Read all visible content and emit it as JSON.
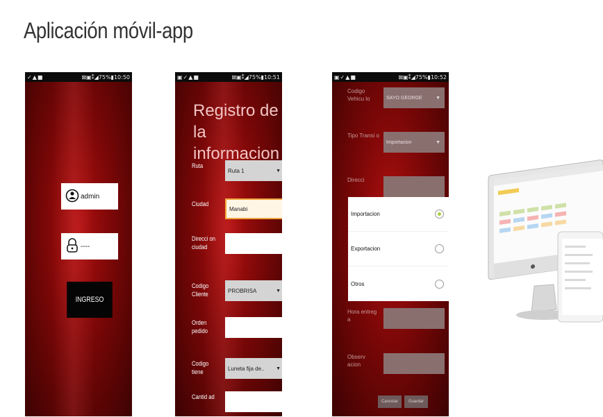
{
  "slide": {
    "title": "Aplicación móvil-app"
  },
  "status_bars": {
    "login": {
      "left": "✓▲■",
      "right": "⊠▣⁑◢75%▮10:50"
    },
    "form": {
      "left": "▣✓▲■",
      "right": "⊠▣⁑◢75%▮10:51"
    },
    "dialog": {
      "left": "▣✓▲■",
      "right": "⊠▣⁑◢75%▮10:52"
    }
  },
  "login": {
    "username": "admin",
    "password": "----",
    "submit_label": "INGRESO",
    "user_icon": "user-icon",
    "lock_icon": "lock-icon"
  },
  "form": {
    "title": "Registro de la informacion",
    "fields": [
      {
        "label": "Ruta",
        "value": "Ruta 1",
        "type": "select"
      },
      {
        "label": "Ciudad",
        "value": "Manabi",
        "type": "input-focused"
      },
      {
        "label": "Direcci on ciudad",
        "value": "",
        "type": "input"
      },
      {
        "label": "Codigo Cliente",
        "value": "PROBRISA",
        "type": "select"
      },
      {
        "label": "Orden pedido",
        "value": "",
        "type": "input"
      },
      {
        "label": "Codigo tiene",
        "value": "Luneta fija de..",
        "type": "select"
      },
      {
        "label": "Cantid ad",
        "value": "",
        "type": "input"
      }
    ]
  },
  "dialog_screen": {
    "background_fields": [
      {
        "label": "Codigo Vehicu lo",
        "value": "SAYO GEORGE",
        "type": "select"
      },
      {
        "label": "Tipo Transi o",
        "value": "Importacion",
        "type": "select"
      },
      {
        "label": "Direcci",
        "value": "",
        "type": "input"
      },
      {
        "label": "Hora entreg a",
        "value": "",
        "type": "input"
      },
      {
        "label": "Observ acion",
        "value": "",
        "type": "input"
      }
    ],
    "options": [
      {
        "label": "Importacion",
        "checked": true
      },
      {
        "label": "Exportacion",
        "checked": false
      },
      {
        "label": "Otros",
        "checked": false
      }
    ],
    "buttons": [
      "Cancelar",
      "Guardar"
    ]
  },
  "colors": {
    "phone_red": "#7a0707",
    "accent_focus": "#f0a63c",
    "radio_checked": "#a8cf3a"
  }
}
